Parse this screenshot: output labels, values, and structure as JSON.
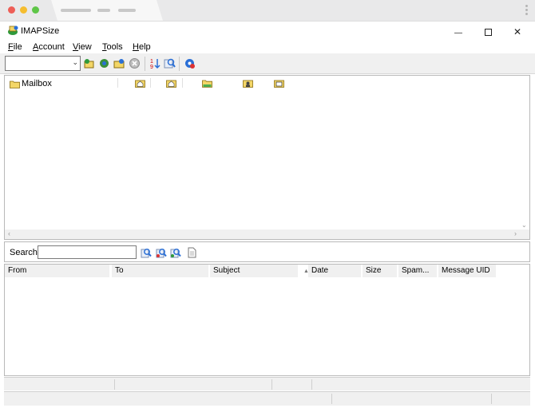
{
  "window": {
    "title": "IMAPSize",
    "minimize_glyph": "—",
    "close_glyph": "✕"
  },
  "menu": {
    "items": [
      {
        "label": "File",
        "mnemonic": "F",
        "rest": "ile"
      },
      {
        "label": "Account",
        "mnemonic": "A",
        "rest": "ccount"
      },
      {
        "label": "View",
        "mnemonic": "V",
        "rest": "iew"
      },
      {
        "label": "Tools",
        "mnemonic": "T",
        "rest": "ools"
      },
      {
        "label": "Help",
        "mnemonic": "H",
        "rest": "elp"
      }
    ]
  },
  "toolbar": {
    "account_combo_value": "",
    "combo_arrow": "⌄",
    "icons": [
      "connect-icon",
      "refresh-icon",
      "folder-open-icon",
      "stop-icon",
      "sort-icon",
      "search-tool-icon",
      "settings-gear-icon"
    ]
  },
  "tree": {
    "root_label": "Mailbox",
    "column_icons": [
      "home-icon",
      "home-icon",
      "folder-icon",
      "user-icon",
      "inbox-icon"
    ]
  },
  "search": {
    "label": "Search",
    "value": "",
    "icons": [
      "search-from-icon",
      "search-to-icon",
      "search-subject-icon",
      "document-icon"
    ]
  },
  "messages": {
    "columns": [
      "From",
      "To",
      "Subject",
      "Date",
      "Size",
      "Spam...",
      "Message UID"
    ],
    "sort_indicator": "▲",
    "rows": []
  },
  "colors": {
    "accent": "#2a6fd6",
    "folder_yellow": "#f3d667",
    "toolbar_bg": "#f0f0f0"
  }
}
